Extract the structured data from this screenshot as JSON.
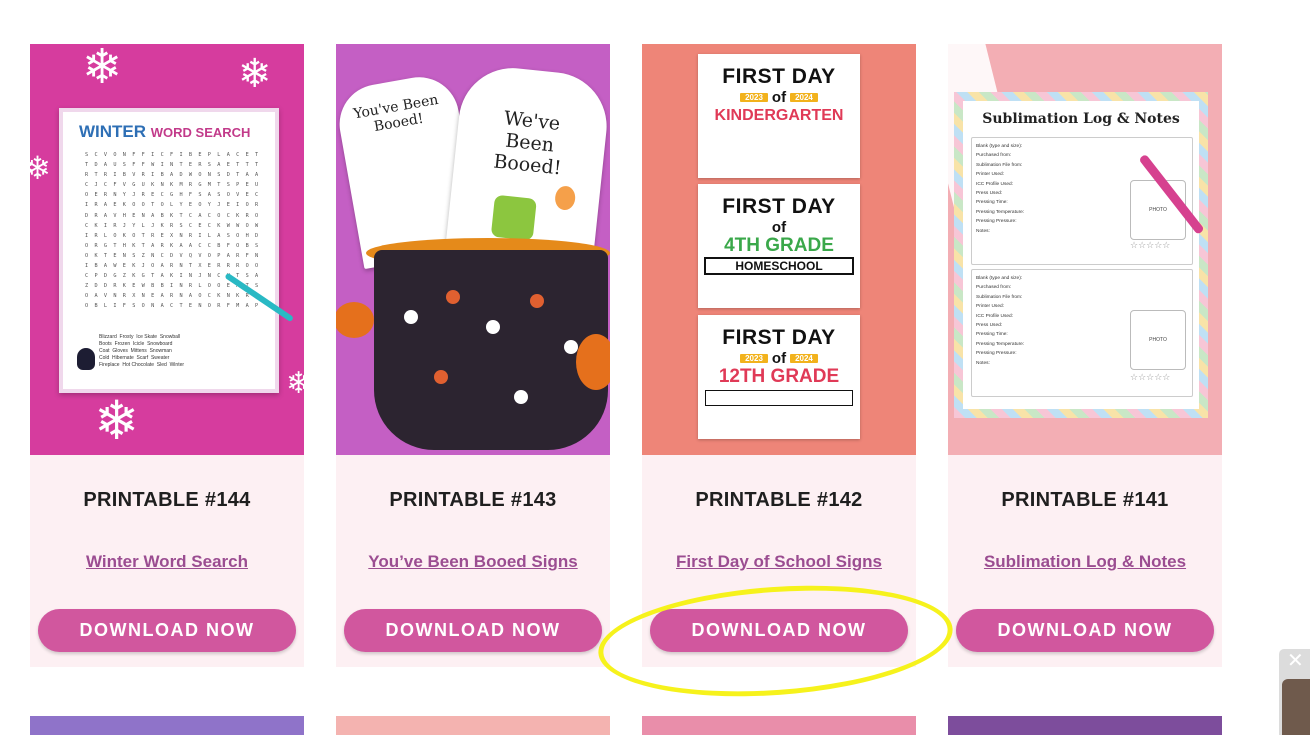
{
  "cards": [
    {
      "title": "PRINTABLE #144",
      "link": "Winter Word Search",
      "button": "DOWNLOAD NOW",
      "image": {
        "heading_a": "WINTER",
        "heading_b": "WORD SEARCH",
        "words": "Blizzard  Frosty  Ice Skate  Snowball\nBoots  Frozen  Icicle  Snowboard\nCoat  Gloves  Mittens  Snowman\nCold  Hibernate  Scarf  Sweater\nFireplace  Hot Chocolate  Sled  Winter"
      }
    },
    {
      "title": "PRINTABLE #143",
      "link": "You’ve Been Booed Signs",
      "button": "DOWNLOAD NOW",
      "image": {
        "sign_a": "You've Been Booed!",
        "sign_b": "We've Been Booed!"
      }
    },
    {
      "title": "PRINTABLE #142",
      "link": "First Day of School Signs",
      "button": "DOWNLOAD NOW",
      "image": {
        "signs": [
          {
            "line1": "FIRST DAY",
            "y1": "2023",
            "of": "of",
            "y2": "2024",
            "line2": "KINDERGARTEN"
          },
          {
            "line1": "FIRST DAY",
            "y1": "",
            "of": "of",
            "y2": "",
            "line2": "4TH GRADE",
            "line3": "HOMESCHOOL"
          },
          {
            "line1": "FIRST DAY",
            "y1": "2023",
            "of": "of",
            "y2": "2024",
            "line2": "12TH GRADE"
          }
        ]
      }
    },
    {
      "title": "PRINTABLE #141",
      "link": "Sublimation Log & Notes",
      "button": "DOWNLOAD NOW",
      "image": {
        "heading": "Sublimation Log & Notes",
        "fields_a": [
          "Blank (type and size):",
          "Purchased from:",
          "Sublimation File from:",
          "Printer Used:",
          "ICC Profile Used:",
          "Press Used:",
          "Pressing Time:",
          "Pressing Temperature:",
          "Pressing Pressure:",
          "Notes:"
        ],
        "fields_b": [
          "Blank (type and size):",
          "Purchased from:",
          "Sublimation File from:",
          "Printer Used:",
          "ICC Profile Used:",
          "Press Used:",
          "Pressing Time:",
          "Pressing Temperature:",
          "Pressing Pressure:",
          "Notes:"
        ],
        "photo": "PHOTO",
        "stars": "☆☆☆☆☆"
      }
    }
  ],
  "popup": {
    "close_symbol": "✕"
  },
  "colors": {
    "button": "#d1579e",
    "link": "#9b4d91",
    "card_bg": "#fdf0f3",
    "highlight": "#f6f21c"
  }
}
